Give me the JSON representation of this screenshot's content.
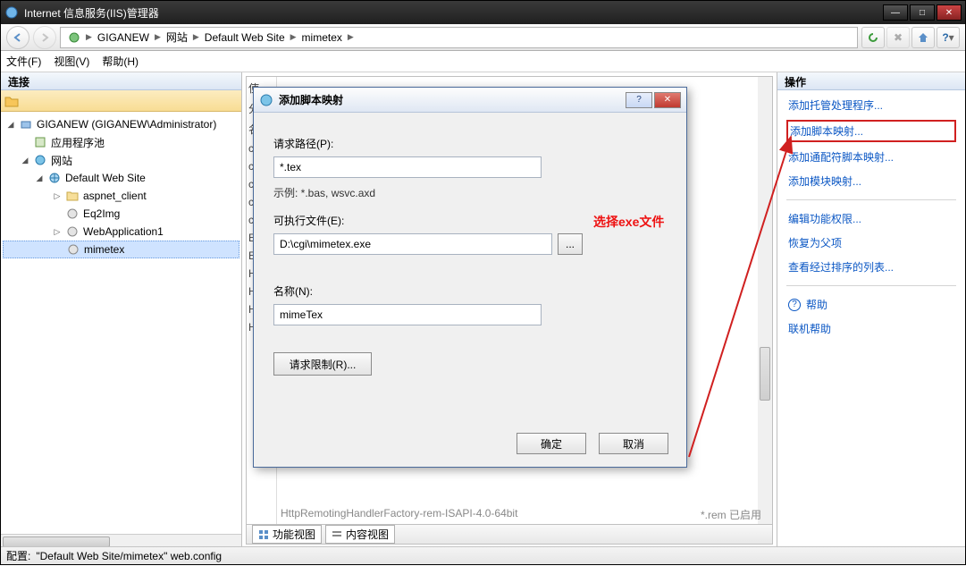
{
  "window": {
    "title": "Internet 信息服务(IIS)管理器"
  },
  "breadcrumb": [
    "GIGANEW",
    "网站",
    "Default Web Site",
    "mimetex"
  ],
  "menu": [
    "文件(F)",
    "视图(V)",
    "帮助(H)"
  ],
  "panes": {
    "left": "连接",
    "right": "操作"
  },
  "tree": {
    "root": "GIGANEW (GIGANEW\\Administrator)",
    "apppool": "应用程序池",
    "sites": "网站",
    "site": "Default Web Site",
    "children": [
      "aspnet_client",
      "Eq2Img",
      "WebApplication1",
      "mimetex"
    ]
  },
  "center": {
    "strip": [
      "使",
      "分",
      "名",
      "cs",
      "cs",
      "cs",
      "cs",
      "cs",
      "Ex",
      "Ex",
      "H1",
      "H1",
      "H1",
      "H1"
    ],
    "footline_left": "HttpRemotingHandlerFactory-rem-ISAPI-4.0-64bit",
    "footline_right": "*.rem            已启用",
    "view_tabs": [
      "功能视图",
      "内容视图"
    ]
  },
  "dialog": {
    "title": "添加脚本映射",
    "path_label": "请求路径(P):",
    "path_value": "*.tex",
    "example": "示例: *.bas, wsvc.axd",
    "exec_label": "可执行文件(E):",
    "exec_value": "D:\\cgi\\mimetex.exe",
    "browse": "...",
    "name_label": "名称(N):",
    "name_value": "mimeTex",
    "req_restrict": "请求限制(R)...",
    "ok": "确定",
    "cancel": "取消",
    "annotation": "选择exe文件"
  },
  "actions": {
    "add_managed": "添加托管处理程序...",
    "add_script": "添加脚本映射...",
    "add_wildcard": "添加通配符脚本映射...",
    "add_module": "添加模块映射...",
    "edit_perm": "编辑功能权限...",
    "revert": "恢复为父项",
    "view_ordered": "查看经过排序的列表...",
    "help": "帮助",
    "online_help": "联机帮助"
  },
  "status": {
    "label": "配置:",
    "value": "\"Default Web Site/mimetex\"  web.config"
  }
}
